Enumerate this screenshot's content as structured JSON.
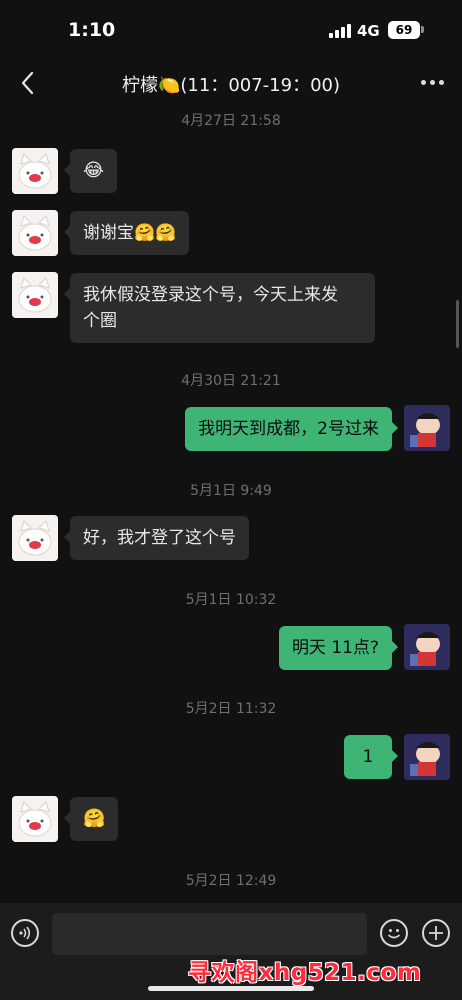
{
  "status": {
    "time": "1:10",
    "network": "4G",
    "battery": "69"
  },
  "header": {
    "title": "柠檬🍋(11：007-19：00)"
  },
  "messages": {
    "t1": "4月27日 21:58",
    "m1": "😂",
    "m2": "谢谢宝🤗🤗",
    "m3_line1": "我休假没登录这个号，今天上来发",
    "m3_line2": "个圈",
    "t2": "4月30日 21:21",
    "m4": "我明天到成都，2号过来",
    "t3": "5月1日 9:49",
    "m5": "好，我才登了这个号",
    "t4": "5月1日 10:32",
    "m6": "明天 11点?",
    "t5": "5月2日 11:32",
    "m7": "1",
    "m8": "🤗",
    "t6": "5月2日 12:49"
  },
  "input": {
    "placeholder": ""
  },
  "watermark": "寻欢阁xhg521.com",
  "icons": {
    "back": "back-chevron-icon",
    "more": "more-dots-icon",
    "voice": "voice-icon",
    "emoji": "emoji-icon",
    "plus": "plus-icon"
  },
  "colors": {
    "outgoing_bubble": "#3eb575",
    "incoming_bubble": "#2c2c2c",
    "background": "#111111"
  }
}
